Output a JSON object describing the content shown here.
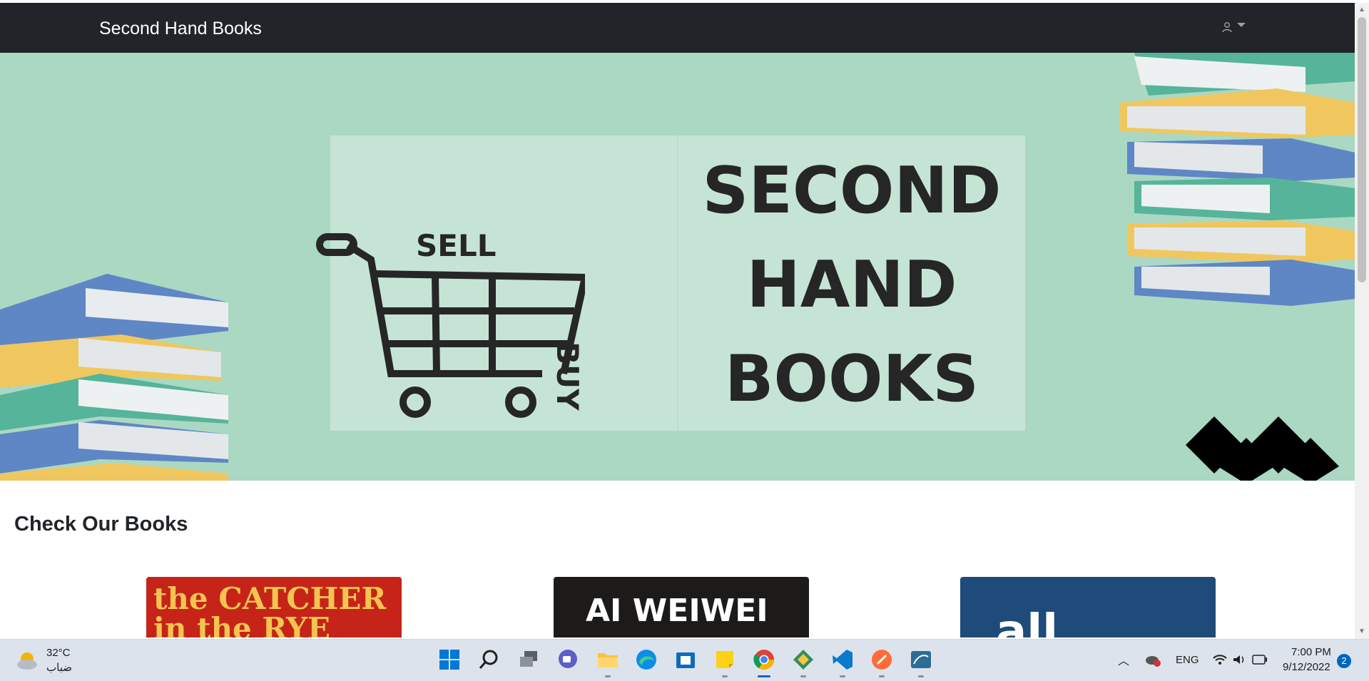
{
  "navbar": {
    "brand": "Second Hand Books",
    "user_icon": "user-icon"
  },
  "hero": {
    "title_line1": "SECOND",
    "title_line2": "HAND",
    "title_line3": "BOOKS",
    "sell_label": "SELL",
    "buy_label": "BUY"
  },
  "section": {
    "title": "Check Our Books"
  },
  "books": [
    {
      "cover_text": "the CATCHER in the RYE"
    },
    {
      "cover_text": "AI WEIWEI"
    },
    {
      "cover_text": "all"
    }
  ],
  "taskbar": {
    "temperature": "32°C",
    "weather_desc": "ضباب",
    "language": "ENG",
    "time": "7:00 PM",
    "date": "9/12/2022",
    "notifications": "2"
  },
  "colors": {
    "navbar_bg": "#212529",
    "hero_bg": "#aad8c2",
    "hero_panel": "#c6e4d5"
  }
}
